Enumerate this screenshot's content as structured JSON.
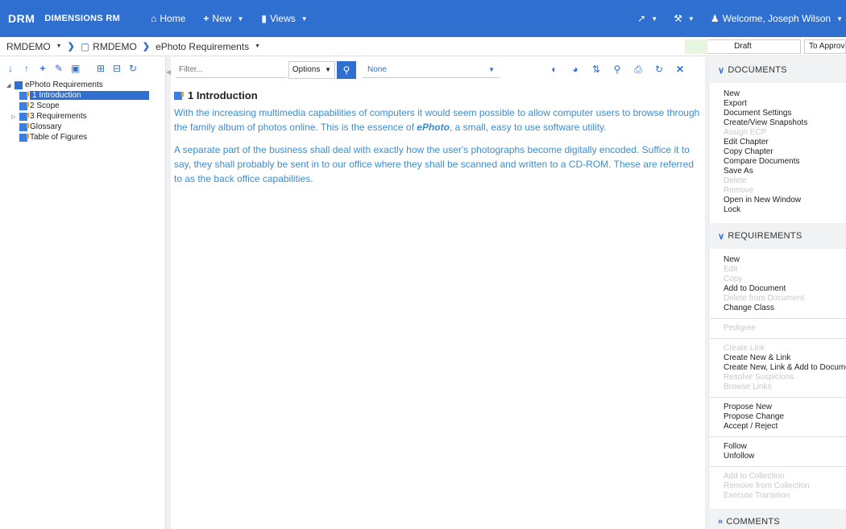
{
  "app": {
    "brand_short": "DRM",
    "brand_name": "DIMENSIONS RM"
  },
  "nav": {
    "home": "Home",
    "new": "New",
    "views": "Views",
    "welcome": "Welcome, Joseph Wilson"
  },
  "breadcrumb": {
    "project": "RMDEMO",
    "folder": "RMDEMO",
    "document": "ePhoto Requirements"
  },
  "status": {
    "current": "Draft",
    "next": "To Approval"
  },
  "tree": {
    "root": "ePhoto Requirements",
    "items": [
      {
        "label": "1 Introduction"
      },
      {
        "label": "2 Scope"
      },
      {
        "label": "3 Requirements"
      },
      {
        "label": "Glossary"
      },
      {
        "label": "Table of Figures"
      }
    ]
  },
  "toolbar": {
    "filter_placeholder": "Filter...",
    "options_label": "Options",
    "view_select": "None"
  },
  "content": {
    "section_title": "1 Introduction",
    "para1_a": "With the increasing multimedia capabilities of computers it would seem possible to allow computer users to browse through the family album of photos online. This is the essence of ",
    "para1_em": "ePhoto",
    "para1_b": ", a small, easy to use software utility.",
    "para2": "A separate part of the business shall deal with exactly how the user's photographs become digitally encoded. Suffice it to say, they shall probably be sent in to our office where they shall be scanned and written to a CD-ROM. These are referred to as the back office capabilities."
  },
  "right_panel": {
    "documents_title": "DOCUMENTS",
    "documents": [
      {
        "label": "New",
        "enabled": true
      },
      {
        "label": "Export",
        "enabled": true
      },
      {
        "label": "Document Settings",
        "enabled": true
      },
      {
        "label": "Create/View Snapshots",
        "enabled": true
      },
      {
        "label": "Assign ECP",
        "enabled": false
      },
      {
        "label": "Edit Chapter",
        "enabled": true
      },
      {
        "label": "Copy Chapter",
        "enabled": true
      },
      {
        "label": "Compare Documents",
        "enabled": true
      },
      {
        "label": "Save As",
        "enabled": true
      },
      {
        "label": "Delete",
        "enabled": false
      },
      {
        "label": "Remove",
        "enabled": false
      },
      {
        "label": "Open in New Window",
        "enabled": true
      },
      {
        "label": "Lock",
        "enabled": true
      }
    ],
    "requirements_title": "REQUIREMENTS",
    "requirements_groups": [
      [
        {
          "label": "New",
          "enabled": true
        },
        {
          "label": "Edit",
          "enabled": false
        },
        {
          "label": "Copy",
          "enabled": false
        },
        {
          "label": "Add to Document",
          "enabled": true
        },
        {
          "label": "Delete from Document",
          "enabled": false
        },
        {
          "label": "Change Class",
          "enabled": true
        }
      ],
      [
        {
          "label": "Pedigree",
          "enabled": false
        }
      ],
      [
        {
          "label": "Create Link",
          "enabled": false
        },
        {
          "label": "Create New & Link",
          "enabled": true
        },
        {
          "label": "Create New, Link & Add to Document",
          "enabled": true
        },
        {
          "label": "Resolve Suspicions",
          "enabled": false
        },
        {
          "label": "Browse Links",
          "enabled": false
        }
      ],
      [
        {
          "label": "Propose New",
          "enabled": true
        },
        {
          "label": "Propose Change",
          "enabled": true
        },
        {
          "label": "Accept / Reject",
          "enabled": true
        }
      ],
      [
        {
          "label": "Follow",
          "enabled": true
        },
        {
          "label": "Unfollow",
          "enabled": true
        }
      ],
      [
        {
          "label": "Add to Collection",
          "enabled": false
        },
        {
          "label": "Remove from Collection",
          "enabled": false
        },
        {
          "label": "Execute Transition",
          "enabled": false
        }
      ]
    ],
    "comments_title": "COMMENTS"
  },
  "colors": {
    "accent": "#2f6fd0",
    "text_blue": "#3d8dd0",
    "disabled": "#c8c8c8"
  }
}
